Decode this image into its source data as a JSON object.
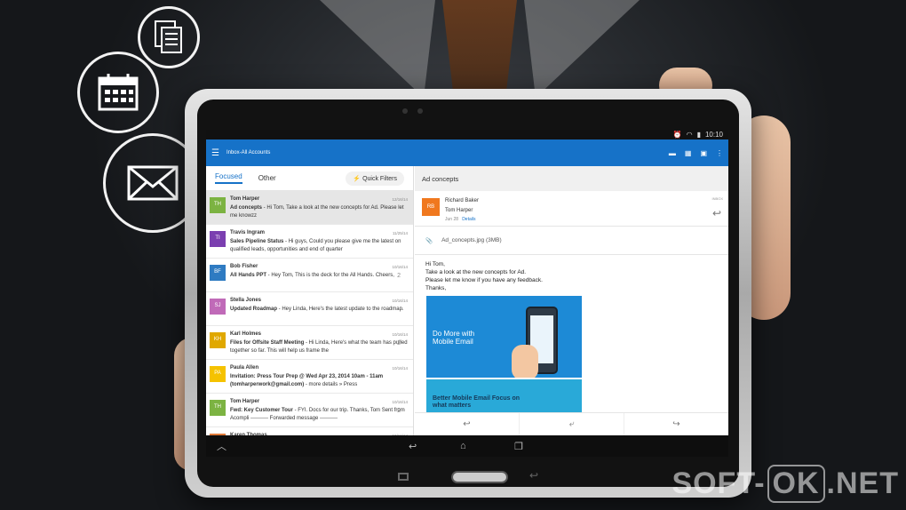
{
  "app": {
    "title": "Inbox-All Accounts",
    "time": "10:10"
  },
  "tabs": {
    "focused": "Focused",
    "other": "Other",
    "quick_filters": "Quick Filters"
  },
  "mails": [
    {
      "initials": "TH",
      "color": "#7cb342",
      "from": "Tom Harper",
      "date": "12/16/14",
      "subject": "Ad concepts",
      "preview": " - Hi Tom, Take a look at the new concepts for Ad. Please let me knowzz",
      "count": ""
    },
    {
      "initials": "TI",
      "color": "#7b3fb0",
      "from": "Travis Ingram",
      "date": "11/25/14",
      "subject": "Sales Pipeline Status",
      "preview": " - Hi guys, Could you please give me the latest on qualified leads, opportunities and end of quarter",
      "count": ""
    },
    {
      "initials": "BF",
      "color": "#2f7bc2",
      "from": "Bob Fisher",
      "date": "10/16/14",
      "subject": "All Hands PPT",
      "preview": " - Hey Tom, This is the deck for the All Hands. Cheers,",
      "count": "2"
    },
    {
      "initials": "SJ",
      "color": "#c06ab8",
      "from": "Stella Jones",
      "date": "10/16/14",
      "subject": "Updated Roadmap",
      "preview": " - Hey Linda, Here's the latest update to the roadmap.",
      "count": ""
    },
    {
      "initials": "KH",
      "color": "#e0a800",
      "from": "Karl Holmes",
      "date": "10/16/14",
      "subject": "Files for Offsite Staff Meeting",
      "preview": " - Hi Linda, Here's what the team has pulled together so far. This will help us frame the",
      "count": "2"
    },
    {
      "initials": "PA",
      "color": "#f5c200",
      "from": "Paula Allen",
      "date": "10/16/14",
      "subject": "Invitation: Press Tour Prep @ Wed Apr 23, 2014 10am - 11am (tomharperwork@gmail.com)",
      "preview": " - more details » Press",
      "count": ""
    },
    {
      "initials": "TH",
      "color": "#7cb342",
      "from": "Tom Harper",
      "date": "10/16/14",
      "subject": "Fwd: Key Customer Tour",
      "preview": " - FYI. Docs for our trip. Thanks, Tom Sent from Acompli ---------- Forwarded message ----------",
      "count": "2"
    },
    {
      "initials": "KT",
      "color": "#e07b39",
      "from": "Karen Thomas",
      "date": "10/16/14",
      "subject": "",
      "preview": "",
      "count": ""
    }
  ],
  "reading": {
    "header": "Ad concepts",
    "sender_initials": "RB",
    "sender": "Richard Baker",
    "to": "Tom Harper",
    "date": "Jun 28",
    "details": "Details",
    "folder": "INBOX",
    "attachment": "Ad_concepts.jpg (3MB)",
    "greeting": "Hi Tom,",
    "line1": "Take a look at the new concepts for Ad.",
    "line2": "Please let me know if you have any feedback.",
    "thanks": "Thanks,",
    "img1_text": "Do More with Mobile Email",
    "img2_text": "Better Mobile Email Focus on what matters"
  },
  "watermark": {
    "pre": "SOFT-",
    "ok": "OK",
    "post": ".NET"
  }
}
